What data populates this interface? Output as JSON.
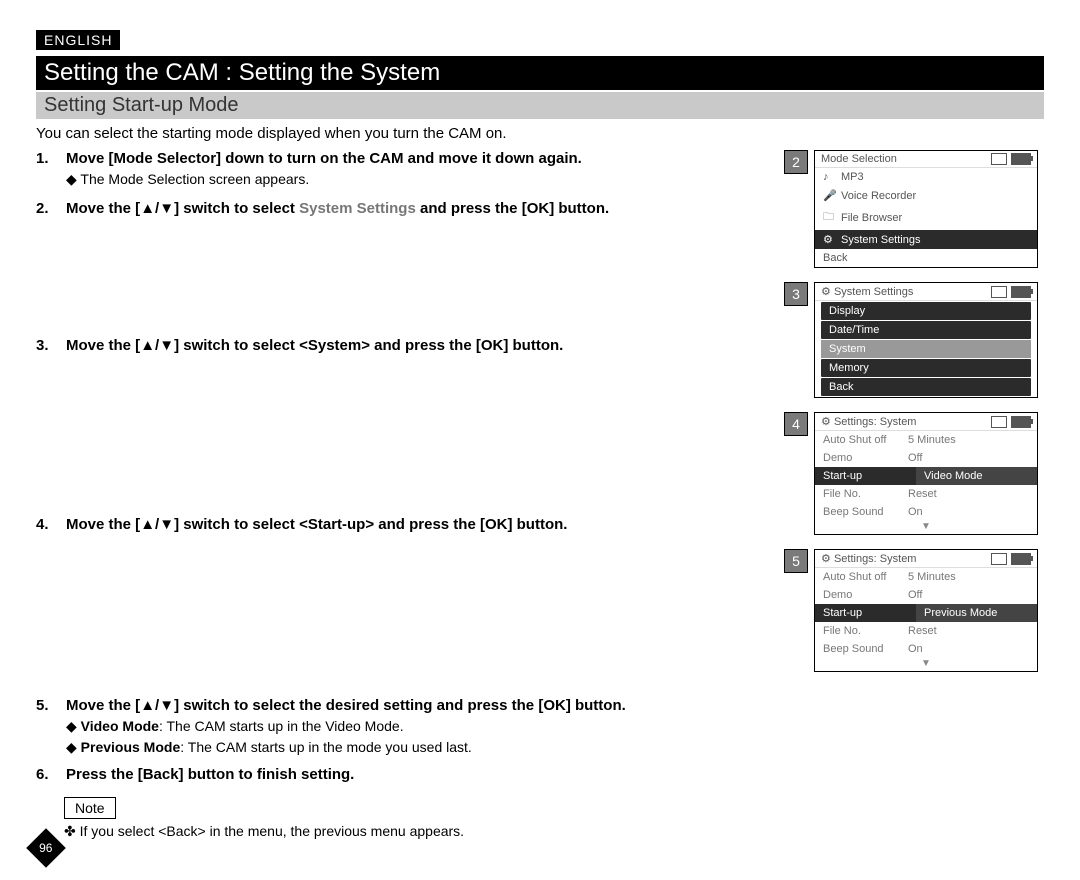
{
  "language_badge": "ENGLISH",
  "title": "Setting the CAM : Setting the System",
  "subtitle": "Setting Start-up Mode",
  "intro": "You can select the starting mode displayed when you turn the CAM on.",
  "steps": {
    "s1": {
      "text_a": "Move [Mode Selector] down to turn on the CAM and move it down again.",
      "sub": "The Mode Selection screen appears."
    },
    "s2": {
      "pre": "Move the [",
      "arrows": "▲/▼",
      "mid": "] switch to select ",
      "target": "System Settings",
      "post": " and press the [OK] button."
    },
    "s3": {
      "pre": "Move the [",
      "arrows": "▲/▼",
      "post": "] switch to select <System> and press the [OK] button."
    },
    "s4": {
      "pre": "Move the [",
      "arrows": "▲/▼",
      "post": "] switch to select <Start-up> and press the [OK] button."
    },
    "s5": {
      "pre": "Move the [",
      "arrows": "▲/▼",
      "post": "] switch to select the desired setting and press the [OK] button.",
      "sub1_b": "Video Mode",
      "sub1_t": ": The CAM starts up in the Video Mode.",
      "sub2_b": "Previous Mode",
      "sub2_t": ": The CAM starts up in the mode you used last."
    },
    "s6": {
      "text": "Press the [Back] button to finish setting."
    }
  },
  "note_label": "Note",
  "note_text": "If you select <Back> in the menu, the previous menu appears.",
  "page_number": "96",
  "screens": {
    "sc2": {
      "num": "2",
      "title": "Mode Selection",
      "items": [
        {
          "icon": "♪",
          "label": "MP3",
          "sel": false
        },
        {
          "icon": "🎤",
          "label": "Voice Recorder",
          "sel": false
        },
        {
          "icon": "🗀",
          "label": "File Browser",
          "sel": false
        },
        {
          "icon": "⚙",
          "label": "System Settings",
          "sel": true
        }
      ],
      "back": "Back"
    },
    "sc3": {
      "num": "3",
      "title": "System Settings",
      "icon": "⚙",
      "items": [
        "Display",
        "Date/Time",
        "System",
        "Memory",
        "Back"
      ],
      "sel_index": 2
    },
    "sc4": {
      "num": "4",
      "title": "Settings: System",
      "icon": "⚙",
      "rows": [
        {
          "k": "Auto Shut off",
          "v": "5 Minutes"
        },
        {
          "k": "Demo",
          "v": "Off"
        },
        {
          "k": "Start-up",
          "v": "Video Mode"
        },
        {
          "k": "File No.",
          "v": "Reset"
        },
        {
          "k": "Beep Sound",
          "v": "On"
        }
      ],
      "sel_index": 2
    },
    "sc5": {
      "num": "5",
      "title": "Settings: System",
      "icon": "⚙",
      "rows": [
        {
          "k": "Auto Shut off",
          "v": "5 Minutes"
        },
        {
          "k": "Demo",
          "v": "Off"
        },
        {
          "k": "Start-up",
          "v": "Previous Mode"
        },
        {
          "k": "File No.",
          "v": "Reset"
        },
        {
          "k": "Beep Sound",
          "v": "On"
        }
      ],
      "sel_index": 2
    }
  }
}
